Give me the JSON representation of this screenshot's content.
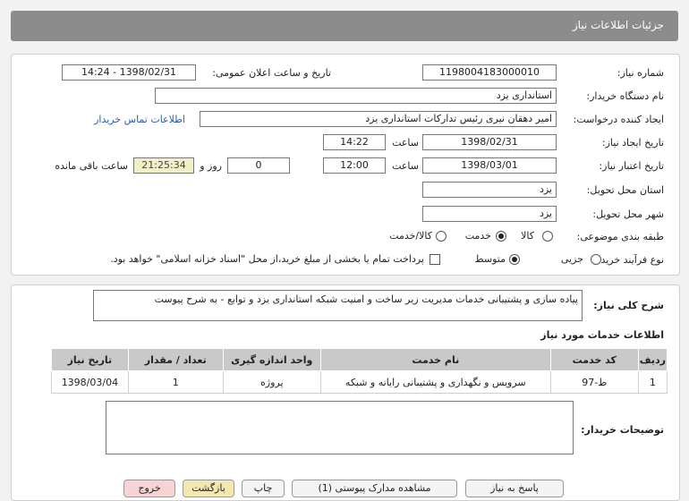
{
  "header": {
    "title": "جزئیات اطلاعات نیاز"
  },
  "form": {
    "need_number_label": "شماره نیاز:",
    "need_number": "1198004183000010",
    "announce_label": "تاریخ و ساعت اعلان عمومی:",
    "announce_value": "1398/02/31 - 14:24",
    "buyer_org_label": "نام دستگاه خریدار:",
    "buyer_org": "استانداری یزد",
    "requester_label": "ایجاد کننده درخواست:",
    "requester": "امیر دهقان نیری رئیس تدارکات استانداری یزد",
    "contact_link": "اطلاعات تماس خریدار",
    "created_label": "تاریخ ایجاد نیاز:",
    "created_date": "1398/02/31",
    "time_label": "ساعت",
    "created_time": "14:22",
    "validity_label": "تاریخ اعتبار نیاز:",
    "validity_date": "1398/03/01",
    "validity_time": "12:00",
    "days_value": "0",
    "days_label": "روز و",
    "remaining_value": "21:25:34",
    "remaining_label": "ساعت باقی مانده",
    "province_label": "استان محل تحویل:",
    "province": "یزد",
    "city_label": "شهر محل تحویل:",
    "city": "یزد",
    "category_label": "طبقه بندی موضوعی:",
    "category_options": [
      "کالا",
      "خدمت",
      "کالا/خدمت"
    ],
    "category_selected": "خدمت",
    "process_label": "نوع فرآیند خرید :",
    "process_options": [
      "جزیی",
      "متوسط"
    ],
    "process_selected": "متوسط",
    "payment_note": "پرداخت تمام یا بخشی از مبلغ خرید،از محل \"اسناد خزانه اسلامی\" خواهد بود."
  },
  "summary": {
    "label": "شرح کلی نیاز:",
    "text": "پیاده سازی و پشتیبانی خدمات مدیریت زیر ساخت و امنیت شبکه استانداری یزد و توابع - به شرح پیوست"
  },
  "services": {
    "title": "اطلاعات خدمات مورد نیاز",
    "columns": [
      "ردیف",
      "کد خدمت",
      "نام خدمت",
      "واحد اندازه گیری",
      "تعداد / مقدار",
      "تاریخ نیاز"
    ],
    "rows": [
      [
        "1",
        "ط-97",
        "سرویس و نگهداری و پشتیبانی رایانه و شبکه",
        "پروژه",
        "1",
        "1398/03/04"
      ]
    ]
  },
  "buyer_notes": {
    "label": "توضیحات خریدار:",
    "text": ""
  },
  "buttons": {
    "reply": "پاسخ به نیاز",
    "view_docs": "مشاهده مدارک پیوستی (1)",
    "print": "چاپ",
    "back": "بازگشت",
    "exit": "خروج"
  },
  "colors": {
    "header_bg": "#8c8c8c",
    "remaining_bg": "#f0efc8",
    "link": "#2a5db0"
  }
}
